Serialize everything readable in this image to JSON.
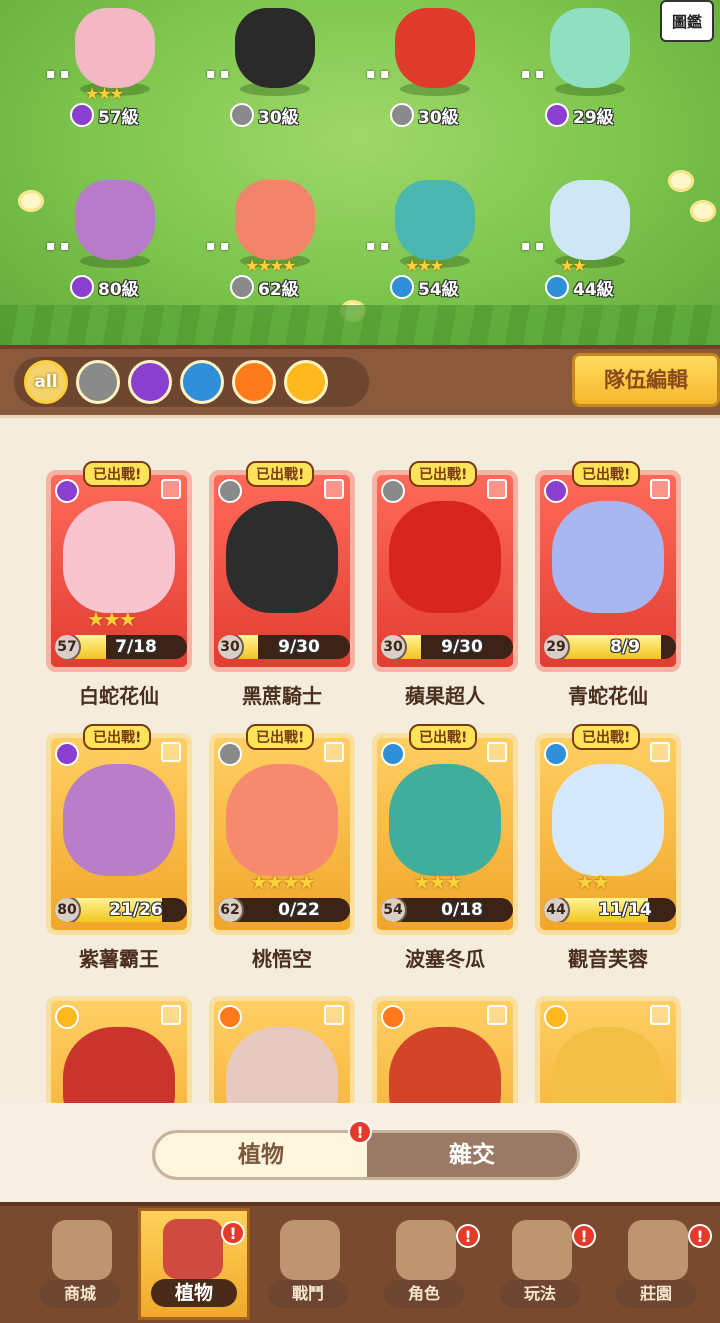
{
  "atlas_label": "圖鑑",
  "field_units": [
    {
      "element": "potion",
      "level": "57級",
      "stars": "★★★",
      "color": "#f4b7c4"
    },
    {
      "element": "sword",
      "level": "30級",
      "stars": "",
      "color": "#2a2a2a"
    },
    {
      "element": "sword",
      "level": "30級",
      "stars": "",
      "color": "#e03a2c"
    },
    {
      "element": "potion",
      "level": "29級",
      "stars": "",
      "color": "#8fe0c0"
    },
    {
      "element": "potion",
      "level": "80級",
      "stars": "",
      "color": "#b77bc9"
    },
    {
      "element": "sword",
      "level": "62級",
      "stars": "★★★★",
      "color": "#f3846a"
    },
    {
      "element": "water",
      "level": "54級",
      "stars": "★★★",
      "color": "#4cb7b0"
    },
    {
      "element": "water",
      "level": "44級",
      "stars": "★★",
      "color": "#cfe6f7"
    }
  ],
  "filters": [
    {
      "name": "all",
      "label": "all",
      "icon": "all-icon"
    },
    {
      "name": "sword",
      "icon": "sword-icon"
    },
    {
      "name": "potion",
      "icon": "potion-icon"
    },
    {
      "name": "water",
      "icon": "water-drop-icon"
    },
    {
      "name": "fire",
      "icon": "fire-icon"
    },
    {
      "name": "bolt",
      "icon": "lightning-icon"
    }
  ],
  "team_edit_label": "隊伍編輯",
  "deployed_label": "已出戰",
  "cards": [
    {
      "name": "白蛇花仙",
      "level": "57",
      "progress": "7/18",
      "fill": 0.39,
      "stars": "★★★",
      "element": "potion",
      "rarity": "red",
      "deployed": true,
      "color": "#f7c4cf"
    },
    {
      "name": "黑蔗騎士",
      "level": "30",
      "progress": "9/30",
      "fill": 0.3,
      "stars": "",
      "element": "sword",
      "rarity": "red",
      "deployed": true,
      "color": "#2d2d2d"
    },
    {
      "name": "蘋果超人",
      "level": "30",
      "progress": "9/30",
      "fill": 0.3,
      "stars": "",
      "element": "sword",
      "rarity": "red",
      "deployed": true,
      "color": "#d8251e"
    },
    {
      "name": "青蛇花仙",
      "level": "29",
      "progress": "8/9",
      "fill": 0.89,
      "stars": "",
      "element": "potion",
      "rarity": "red",
      "deployed": true,
      "color": "#a9b6f0"
    },
    {
      "name": "紫薯霸王",
      "level": "80",
      "progress": "21/26",
      "fill": 0.81,
      "stars": "",
      "element": "potion",
      "rarity": "gold",
      "deployed": true,
      "color": "#b97ec8"
    },
    {
      "name": "桃悟空",
      "level": "62",
      "progress": "0/22",
      "fill": 0,
      "stars": "★★★★",
      "element": "sword",
      "rarity": "gold",
      "deployed": true,
      "color": "#f58a6e"
    },
    {
      "name": "波塞冬瓜",
      "level": "54",
      "progress": "0/18",
      "fill": 0,
      "stars": "★★★",
      "element": "water",
      "rarity": "gold",
      "deployed": true,
      "color": "#3fae9a"
    },
    {
      "name": "觀音芙蓉",
      "level": "44",
      "progress": "11/14",
      "fill": 0.79,
      "stars": "★★",
      "element": "water",
      "rarity": "gold",
      "deployed": true,
      "color": "#d6e8fb"
    },
    {
      "name": "",
      "element": "bolt",
      "rarity": "gold",
      "deployed": false,
      "color": "#c9342d"
    },
    {
      "name": "",
      "element": "fire",
      "rarity": "gold",
      "deployed": false,
      "color": "#e8c9c0"
    },
    {
      "name": "",
      "element": "fire",
      "rarity": "gold",
      "deployed": false,
      "color": "#d2452a"
    },
    {
      "name": "",
      "element": "bolt",
      "rarity": "gold",
      "deployed": false,
      "color": "#f2c044"
    }
  ],
  "toggle": {
    "plants": "植物",
    "hybrid": "雜交"
  },
  "nav": [
    {
      "label": "商城",
      "icon": "shop-icon",
      "alert": false
    },
    {
      "label": "植物",
      "icon": "plants-icon",
      "alert": true,
      "active": true
    },
    {
      "label": "戰鬥",
      "icon": "battle-icon",
      "alert": false
    },
    {
      "label": "角色",
      "icon": "character-icon",
      "alert": true
    },
    {
      "label": "玩法",
      "icon": "gameplay-icon",
      "alert": true
    },
    {
      "label": "莊園",
      "icon": "manor-icon",
      "alert": true
    }
  ],
  "alert_glyph": "!"
}
